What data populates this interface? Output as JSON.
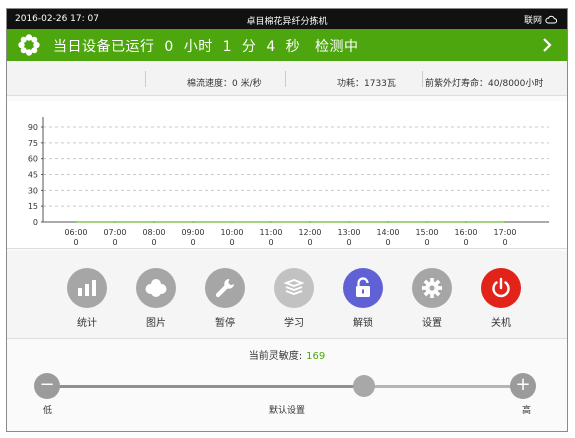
{
  "status_bar": {
    "datetime": "2016-02-26 17: 07",
    "title": "卓目棉花异纤分拣机",
    "network_label": "联网"
  },
  "banner": {
    "run_text": "当日设备已运行  0  小时  1  分  4  秒   检测中",
    "icon": "flower-icon",
    "arrow_icon": "chevron-right-icon",
    "color": "#4da60e"
  },
  "info_bar": {
    "cotton_speed": "棉流速度：0 米/秒",
    "power": "功耗：1733瓦",
    "lamp_life": "前紫外灯寿命：40/8000小时"
  },
  "chart_data": {
    "type": "line",
    "ylim": [
      0,
      90
    ],
    "yticks": [
      0,
      15,
      30,
      45,
      60,
      75,
      90
    ],
    "grid": true,
    "categories": [
      "06:00",
      "07:00",
      "08:00",
      "09:00",
      "10:00",
      "11:00",
      "12:00",
      "13:00",
      "14:00",
      "15:00",
      "16:00",
      "17:00"
    ],
    "values": [
      0,
      0,
      0,
      0,
      0,
      0,
      0,
      0,
      0,
      0,
      0,
      0
    ]
  },
  "buttons": [
    {
      "id": "stats",
      "label": "统计",
      "icon": "bar-chart-icon",
      "color": "#a6a6a6"
    },
    {
      "id": "pictures",
      "label": "图片",
      "icon": "cotton-icon",
      "color": "#a6a6a6"
    },
    {
      "id": "pause",
      "label": "暂停",
      "icon": "wrench-icon",
      "color": "#a6a6a6"
    },
    {
      "id": "learn",
      "label": "学习",
      "icon": "layers-icon",
      "color": "#c2c2c2"
    },
    {
      "id": "unlock",
      "label": "解锁",
      "icon": "unlock-icon",
      "color": "#6161d6"
    },
    {
      "id": "settings",
      "label": "设置",
      "icon": "gear-icon",
      "color": "#a6a6a6"
    },
    {
      "id": "shutdown",
      "label": "关机",
      "icon": "power-icon",
      "color": "#e2231a"
    }
  ],
  "sensitivity": {
    "caption": "当前灵敏度:",
    "value": "169",
    "level": 0.667,
    "low_label": "低",
    "default_label": "默认设置",
    "high_label": "高",
    "minus": "−",
    "plus": "+"
  }
}
